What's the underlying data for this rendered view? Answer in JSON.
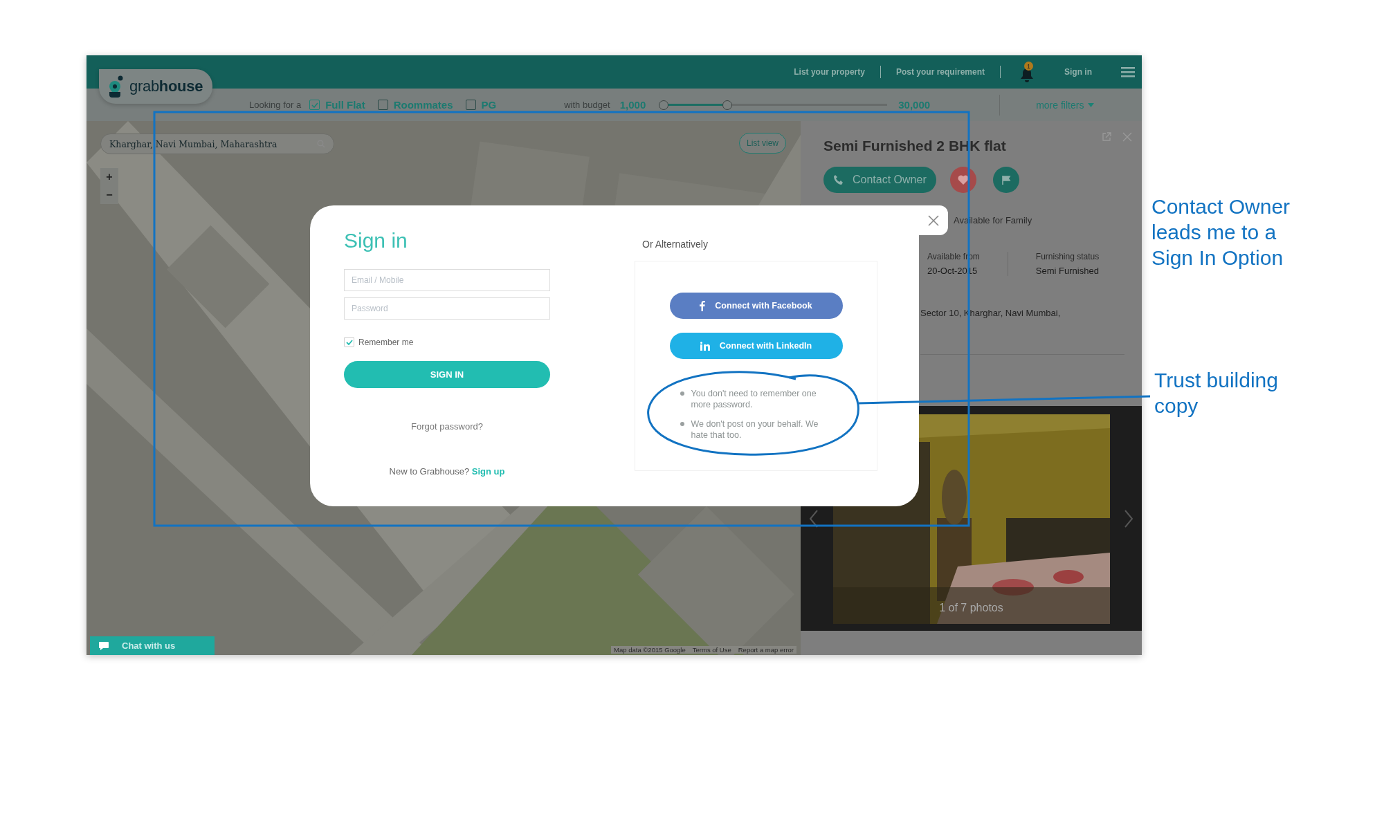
{
  "header": {
    "logo": "grab**house**",
    "links": [
      {
        "label": "List your property"
      },
      {
        "label": "Post your requirement"
      }
    ],
    "notification_count": "1",
    "sign_in": "Sign in"
  },
  "filters": {
    "label": "Looking for a",
    "options": [
      {
        "label": "Full Flat",
        "checked": true
      },
      {
        "label": "Roommates",
        "checked": false
      },
      {
        "label": "PG",
        "checked": false
      }
    ],
    "budget_label": "with budget",
    "budget_min": "1,000",
    "budget_max": "30,000",
    "budget": {
      "level": 0.3
    },
    "more_filters": "more filters"
  },
  "map": {
    "search_value": "Kharghar, Navi Mumbai, Maharashtra",
    "zoom_in": "+",
    "zoom_out": "−",
    "list_view": "List view",
    "attribution": [
      "Map data ©2015 Google",
      "Terms of Use",
      "Report a map error"
    ],
    "chat": "Chat with us"
  },
  "listing": {
    "title": "Semi Furnished 2 BHK flat",
    "contact": "Contact Owner",
    "tenant_type": "Available for Family",
    "facts": [
      {
        "label": "Available from",
        "value": "20-Oct-2015"
      },
      {
        "label": "Furnishing status",
        "value": "Semi Furnished"
      }
    ],
    "address": "Sector 10, Kharghar, Navi Mumbai,",
    "photo_caption": "1 of 7 photos"
  },
  "modal": {
    "title": "Sign in",
    "email_placeholder": "Email / Mobile",
    "password_placeholder": "Password",
    "remember": {
      "label": "Remember me",
      "checked": true
    },
    "submit": "SIGN IN",
    "forgot": "Forgot password?",
    "signup_prompt": "New to Grabhouse?",
    "signup_link": "Sign up",
    "alt_title": "Or Alternatively",
    "social": [
      {
        "kind": "facebook",
        "label": "Connect with Facebook"
      },
      {
        "kind": "linkedin",
        "label": "Connect with LinkedIn"
      }
    ],
    "trust": [
      "You don't need to remember one more password.",
      "We don't post on your behalf. We hate that too."
    ]
  },
  "annotations": [
    {
      "lines": [
        "Contact Owner",
        "leads me to a",
        "Sign In Option"
      ]
    },
    {
      "lines": [
        "Trust building",
        "copy"
      ]
    }
  ]
}
